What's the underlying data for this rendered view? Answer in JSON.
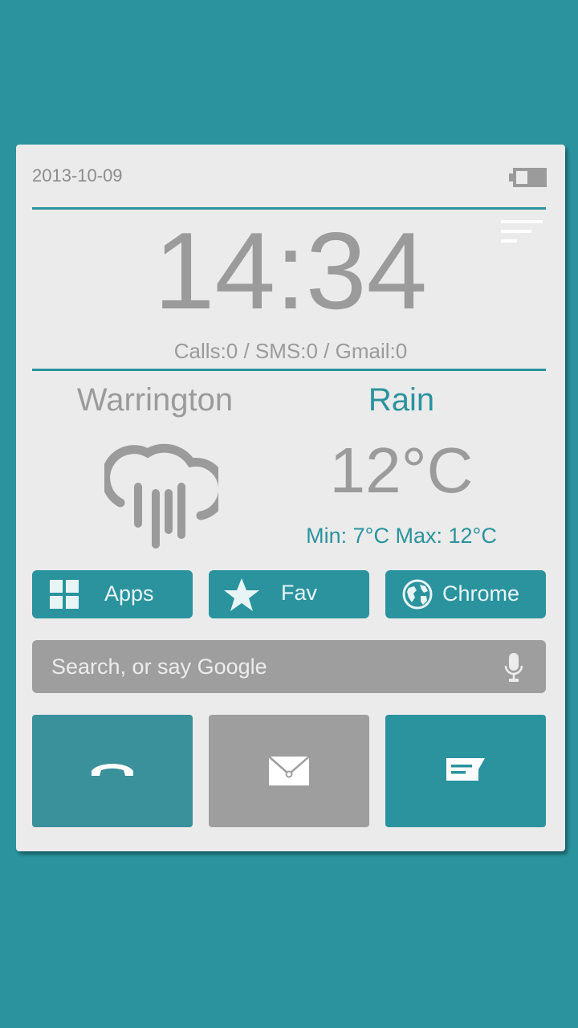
{
  "status": {
    "date": "2013-10-09",
    "battery_icon": "battery-icon"
  },
  "clock": {
    "time": "14:34",
    "notifications": "Calls:0 / SMS:0 / Gmail:0"
  },
  "weather": {
    "city": "Warrington",
    "condition": "Rain",
    "temperature": "12°C",
    "min_max": "Min: 7°C Max: 12°C",
    "icon": "rain-cloud-icon"
  },
  "quick_buttons": [
    {
      "label": "Apps",
      "icon": "grid-icon"
    },
    {
      "label": "Fav",
      "icon": "star-icon"
    },
    {
      "label": "Chrome",
      "icon": "globe-icon"
    }
  ],
  "search": {
    "placeholder": "Search, or say Google",
    "icon": "mic-icon"
  },
  "tiles": [
    {
      "name": "phone",
      "icon": "phone-icon",
      "color": "#3a909b"
    },
    {
      "name": "email",
      "icon": "envelope-icon",
      "color": "#9d9e9d"
    },
    {
      "name": "messaging",
      "icon": "message-icon",
      "color": "#2a939e"
    }
  ],
  "colors": {
    "background": "#2a939e",
    "card": "#ebebeb",
    "accent": "#2a939e",
    "text_gray": "#9b9b9b"
  }
}
